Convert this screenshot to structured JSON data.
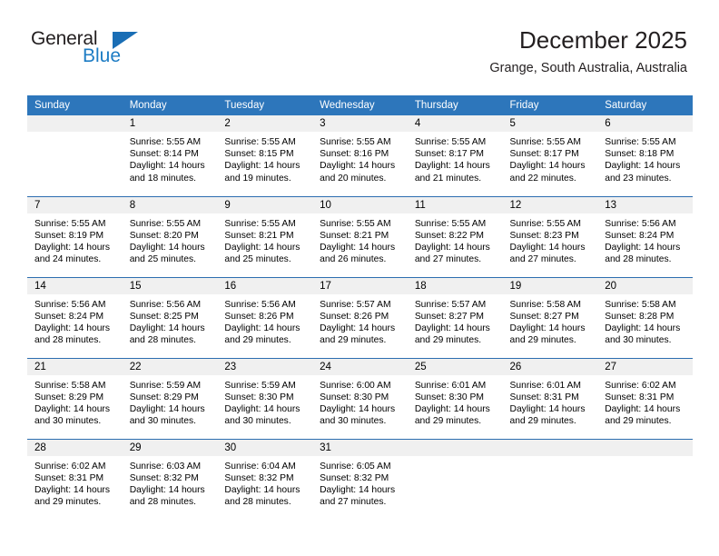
{
  "brand": {
    "name_part1": "General",
    "name_part2": "Blue",
    "accent_color": "#1d7cc4",
    "triangle_color": "#1a6eb5"
  },
  "header": {
    "title": "December 2025",
    "location": "Grange, South Australia, Australia"
  },
  "theme": {
    "header_bg": "#2d76bb",
    "row_divider": "#2d6eb0",
    "daynum_bg": "#f0f0f0"
  },
  "weekday_headers": [
    "Sunday",
    "Monday",
    "Tuesday",
    "Wednesday",
    "Thursday",
    "Friday",
    "Saturday"
  ],
  "weeks": [
    [
      {
        "day": "",
        "sunrise": "",
        "sunset": "",
        "daylight1": "",
        "daylight2": ""
      },
      {
        "day": "1",
        "sunrise": "Sunrise: 5:55 AM",
        "sunset": "Sunset: 8:14 PM",
        "daylight1": "Daylight: 14 hours",
        "daylight2": "and 18 minutes."
      },
      {
        "day": "2",
        "sunrise": "Sunrise: 5:55 AM",
        "sunset": "Sunset: 8:15 PM",
        "daylight1": "Daylight: 14 hours",
        "daylight2": "and 19 minutes."
      },
      {
        "day": "3",
        "sunrise": "Sunrise: 5:55 AM",
        "sunset": "Sunset: 8:16 PM",
        "daylight1": "Daylight: 14 hours",
        "daylight2": "and 20 minutes."
      },
      {
        "day": "4",
        "sunrise": "Sunrise: 5:55 AM",
        "sunset": "Sunset: 8:17 PM",
        "daylight1": "Daylight: 14 hours",
        "daylight2": "and 21 minutes."
      },
      {
        "day": "5",
        "sunrise": "Sunrise: 5:55 AM",
        "sunset": "Sunset: 8:17 PM",
        "daylight1": "Daylight: 14 hours",
        "daylight2": "and 22 minutes."
      },
      {
        "day": "6",
        "sunrise": "Sunrise: 5:55 AM",
        "sunset": "Sunset: 8:18 PM",
        "daylight1": "Daylight: 14 hours",
        "daylight2": "and 23 minutes."
      }
    ],
    [
      {
        "day": "7",
        "sunrise": "Sunrise: 5:55 AM",
        "sunset": "Sunset: 8:19 PM",
        "daylight1": "Daylight: 14 hours",
        "daylight2": "and 24 minutes."
      },
      {
        "day": "8",
        "sunrise": "Sunrise: 5:55 AM",
        "sunset": "Sunset: 8:20 PM",
        "daylight1": "Daylight: 14 hours",
        "daylight2": "and 25 minutes."
      },
      {
        "day": "9",
        "sunrise": "Sunrise: 5:55 AM",
        "sunset": "Sunset: 8:21 PM",
        "daylight1": "Daylight: 14 hours",
        "daylight2": "and 25 minutes."
      },
      {
        "day": "10",
        "sunrise": "Sunrise: 5:55 AM",
        "sunset": "Sunset: 8:21 PM",
        "daylight1": "Daylight: 14 hours",
        "daylight2": "and 26 minutes."
      },
      {
        "day": "11",
        "sunrise": "Sunrise: 5:55 AM",
        "sunset": "Sunset: 8:22 PM",
        "daylight1": "Daylight: 14 hours",
        "daylight2": "and 27 minutes."
      },
      {
        "day": "12",
        "sunrise": "Sunrise: 5:55 AM",
        "sunset": "Sunset: 8:23 PM",
        "daylight1": "Daylight: 14 hours",
        "daylight2": "and 27 minutes."
      },
      {
        "day": "13",
        "sunrise": "Sunrise: 5:56 AM",
        "sunset": "Sunset: 8:24 PM",
        "daylight1": "Daylight: 14 hours",
        "daylight2": "and 28 minutes."
      }
    ],
    [
      {
        "day": "14",
        "sunrise": "Sunrise: 5:56 AM",
        "sunset": "Sunset: 8:24 PM",
        "daylight1": "Daylight: 14 hours",
        "daylight2": "and 28 minutes."
      },
      {
        "day": "15",
        "sunrise": "Sunrise: 5:56 AM",
        "sunset": "Sunset: 8:25 PM",
        "daylight1": "Daylight: 14 hours",
        "daylight2": "and 28 minutes."
      },
      {
        "day": "16",
        "sunrise": "Sunrise: 5:56 AM",
        "sunset": "Sunset: 8:26 PM",
        "daylight1": "Daylight: 14 hours",
        "daylight2": "and 29 minutes."
      },
      {
        "day": "17",
        "sunrise": "Sunrise: 5:57 AM",
        "sunset": "Sunset: 8:26 PM",
        "daylight1": "Daylight: 14 hours",
        "daylight2": "and 29 minutes."
      },
      {
        "day": "18",
        "sunrise": "Sunrise: 5:57 AM",
        "sunset": "Sunset: 8:27 PM",
        "daylight1": "Daylight: 14 hours",
        "daylight2": "and 29 minutes."
      },
      {
        "day": "19",
        "sunrise": "Sunrise: 5:58 AM",
        "sunset": "Sunset: 8:27 PM",
        "daylight1": "Daylight: 14 hours",
        "daylight2": "and 29 minutes."
      },
      {
        "day": "20",
        "sunrise": "Sunrise: 5:58 AM",
        "sunset": "Sunset: 8:28 PM",
        "daylight1": "Daylight: 14 hours",
        "daylight2": "and 30 minutes."
      }
    ],
    [
      {
        "day": "21",
        "sunrise": "Sunrise: 5:58 AM",
        "sunset": "Sunset: 8:29 PM",
        "daylight1": "Daylight: 14 hours",
        "daylight2": "and 30 minutes."
      },
      {
        "day": "22",
        "sunrise": "Sunrise: 5:59 AM",
        "sunset": "Sunset: 8:29 PM",
        "daylight1": "Daylight: 14 hours",
        "daylight2": "and 30 minutes."
      },
      {
        "day": "23",
        "sunrise": "Sunrise: 5:59 AM",
        "sunset": "Sunset: 8:30 PM",
        "daylight1": "Daylight: 14 hours",
        "daylight2": "and 30 minutes."
      },
      {
        "day": "24",
        "sunrise": "Sunrise: 6:00 AM",
        "sunset": "Sunset: 8:30 PM",
        "daylight1": "Daylight: 14 hours",
        "daylight2": "and 30 minutes."
      },
      {
        "day": "25",
        "sunrise": "Sunrise: 6:01 AM",
        "sunset": "Sunset: 8:30 PM",
        "daylight1": "Daylight: 14 hours",
        "daylight2": "and 29 minutes."
      },
      {
        "day": "26",
        "sunrise": "Sunrise: 6:01 AM",
        "sunset": "Sunset: 8:31 PM",
        "daylight1": "Daylight: 14 hours",
        "daylight2": "and 29 minutes."
      },
      {
        "day": "27",
        "sunrise": "Sunrise: 6:02 AM",
        "sunset": "Sunset: 8:31 PM",
        "daylight1": "Daylight: 14 hours",
        "daylight2": "and 29 minutes."
      }
    ],
    [
      {
        "day": "28",
        "sunrise": "Sunrise: 6:02 AM",
        "sunset": "Sunset: 8:31 PM",
        "daylight1": "Daylight: 14 hours",
        "daylight2": "and 29 minutes."
      },
      {
        "day": "29",
        "sunrise": "Sunrise: 6:03 AM",
        "sunset": "Sunset: 8:32 PM",
        "daylight1": "Daylight: 14 hours",
        "daylight2": "and 28 minutes."
      },
      {
        "day": "30",
        "sunrise": "Sunrise: 6:04 AM",
        "sunset": "Sunset: 8:32 PM",
        "daylight1": "Daylight: 14 hours",
        "daylight2": "and 28 minutes."
      },
      {
        "day": "31",
        "sunrise": "Sunrise: 6:05 AM",
        "sunset": "Sunset: 8:32 PM",
        "daylight1": "Daylight: 14 hours",
        "daylight2": "and 27 minutes."
      },
      {
        "day": "",
        "sunrise": "",
        "sunset": "",
        "daylight1": "",
        "daylight2": ""
      },
      {
        "day": "",
        "sunrise": "",
        "sunset": "",
        "daylight1": "",
        "daylight2": ""
      },
      {
        "day": "",
        "sunrise": "",
        "sunset": "",
        "daylight1": "",
        "daylight2": ""
      }
    ]
  ]
}
